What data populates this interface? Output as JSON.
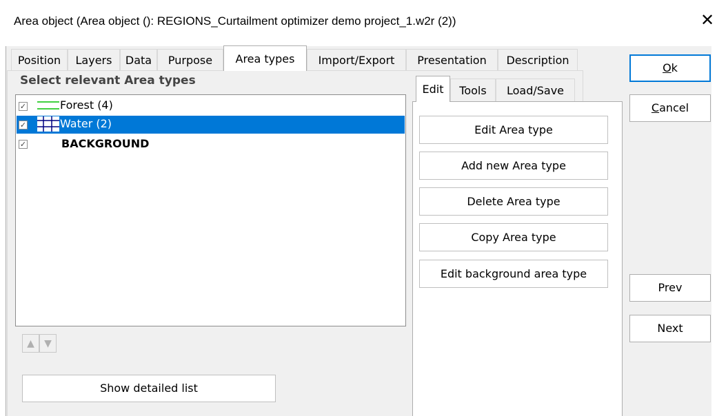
{
  "window": {
    "title": "Area object   (Area object (): REGIONS_Curtailment optimizer demo project_1.w2r (2))",
    "close_glyph": "✕"
  },
  "tabs": [
    {
      "label": "Position"
    },
    {
      "label": "Layers"
    },
    {
      "label": "Data"
    },
    {
      "label": "Purpose"
    },
    {
      "label": "Area types",
      "active": true
    },
    {
      "label": "Import/Export"
    },
    {
      "label": "Presentation"
    },
    {
      "label": "Description"
    }
  ],
  "area_types": {
    "section_title": "Select relevant Area types",
    "items": [
      {
        "label": "Forest (4)",
        "checked": true,
        "icon": "green-lines-icon",
        "selected": false,
        "bold": false
      },
      {
        "label": "Water (2)",
        "checked": true,
        "icon": "hatch-grid-icon",
        "selected": true,
        "bold": false
      },
      {
        "label": "BACKGROUND",
        "checked": true,
        "icon": "none",
        "selected": false,
        "bold": true
      }
    ],
    "show_detailed_list": "Show detailed list",
    "move_up_glyph": "▲",
    "move_down_glyph": "▼"
  },
  "subtabs": [
    {
      "label": "Edit",
      "active": true
    },
    {
      "label": "Tools"
    },
    {
      "label": "Load/Save"
    }
  ],
  "edit_actions": [
    "Edit Area type",
    "Add new Area type",
    "Delete Area type",
    "Copy Area type",
    "Edit background area type"
  ],
  "side_buttons": {
    "ok": "Ok",
    "cancel": "Cancel",
    "prev": "Prev",
    "next": "Next"
  },
  "colors": {
    "selection": "#0078d7",
    "forest_icon": "#00c000",
    "water_icon": "#000080"
  }
}
